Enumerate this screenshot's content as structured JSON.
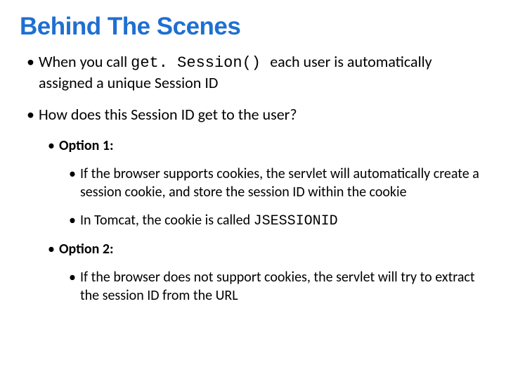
{
  "title": "Behind The Scenes",
  "b1_pre": "When you call ",
  "b1_code": "get. Session() ",
  "b1_post": "each user is automatically assigned a unique Session ID",
  "b2": "How does this Session ID get to the user?",
  "opt1_label": "Option 1:",
  "opt1_item1": "If the browser supports cookies, the servlet will automatically create a session cookie, and store the session ID within the cookie",
  "opt1_item2_pre": "In Tomcat, the cookie is called ",
  "opt1_item2_code": "JSESSIONID",
  "opt2_label": "Option 2:",
  "opt2_item1": "If the browser does not support cookies, the servlet will try to extract the session ID from the URL"
}
